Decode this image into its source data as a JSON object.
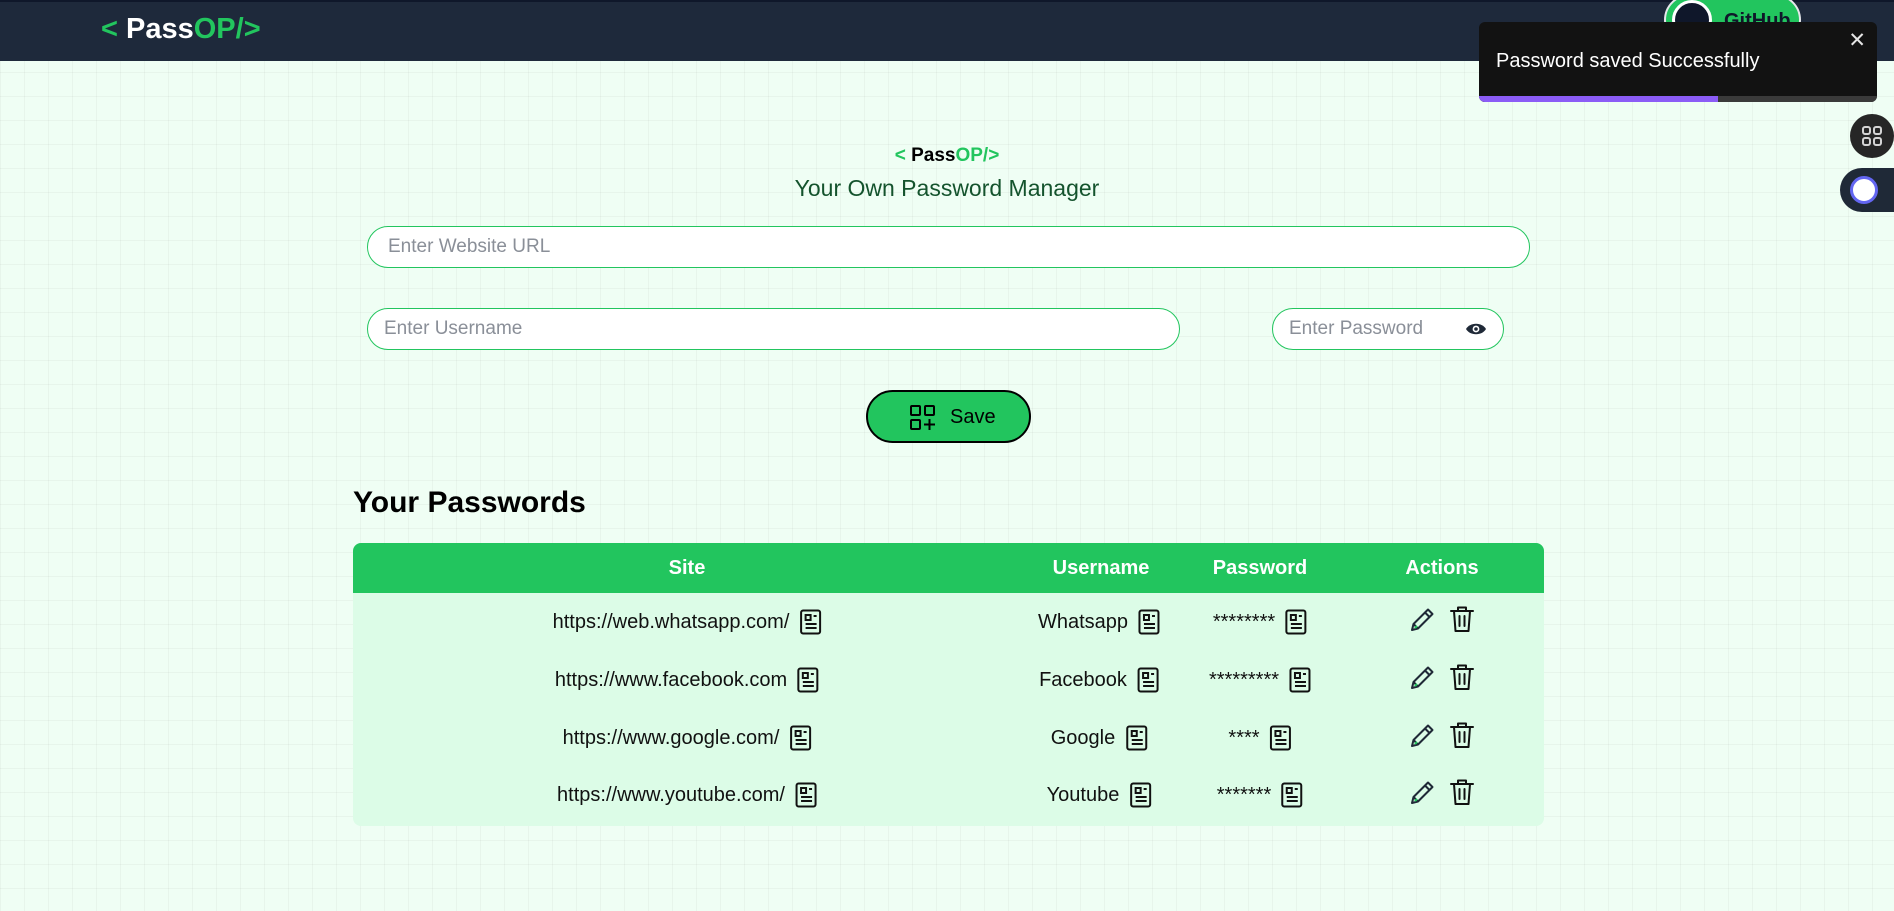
{
  "navbar": {
    "logo": {
      "lt": "<",
      "pass": "Pass",
      "op": "OP/",
      "gt": ">"
    },
    "github_label": "GitHub"
  },
  "toast": {
    "message": "Password saved Successfully",
    "close_symbol": "✕",
    "progress": 0.6
  },
  "header": {
    "logo": {
      "lt": "<",
      "pass": "Pass",
      "op": "OP/",
      "gt": ">"
    },
    "tagline": "Your Own Password Manager"
  },
  "form": {
    "site_placeholder": "Enter Website URL",
    "username_placeholder": "Enter Username",
    "password_placeholder": "Enter Password",
    "save_label": "Save"
  },
  "passwords": {
    "title": "Your Passwords",
    "columns": [
      "Site",
      "Username",
      "Password",
      "Actions"
    ],
    "rows": [
      {
        "site": "https://web.whatsapp.com/",
        "username": "Whatsapp",
        "password": "********"
      },
      {
        "site": "https://www.facebook.com",
        "username": "Facebook",
        "password": "*********"
      },
      {
        "site": "https://www.google.com/",
        "username": "Google",
        "password": "****"
      },
      {
        "site": "https://www.youtube.com/",
        "username": "Youtube",
        "password": "*******"
      }
    ]
  },
  "colors": {
    "accent": "#22c55e",
    "navbar": "#1e293b",
    "table_body": "#dcfce7",
    "toast_progress": "#8b5cf6"
  },
  "icons": {
    "copy": "clipboard-icon",
    "edit": "pencil-icon",
    "delete": "trash-icon",
    "save": "grid-plus-icon",
    "toggle_password": "eye-icon"
  }
}
